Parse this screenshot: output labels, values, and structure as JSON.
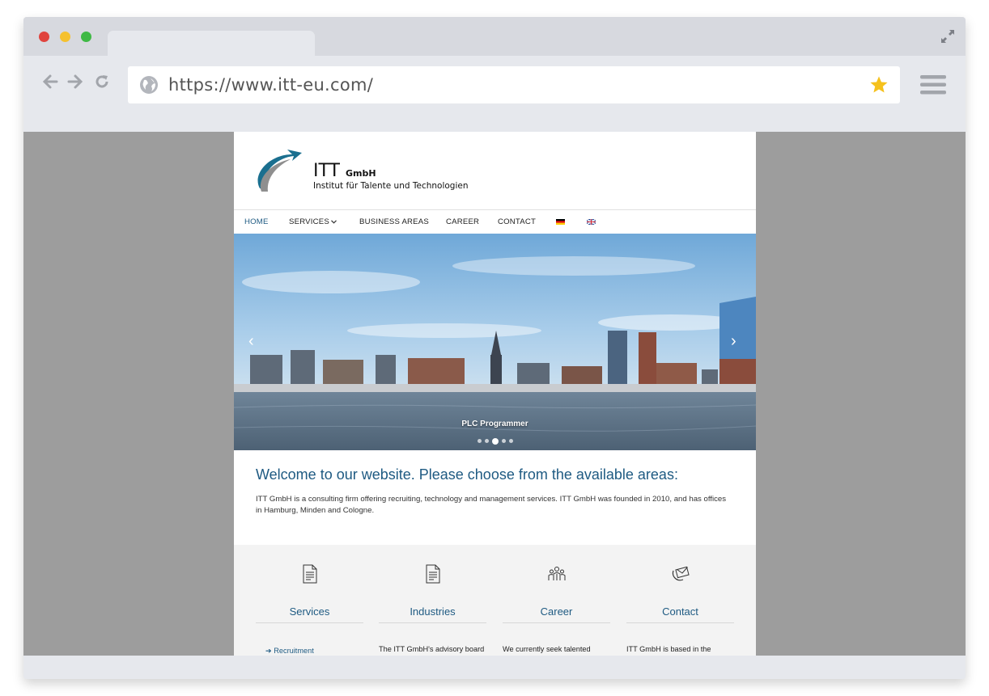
{
  "browser": {
    "url": "https://www.itt-eu.com/",
    "buttons": {
      "back": "back-arrow",
      "forward": "forward-arrow",
      "reload": "reload-icon",
      "bookmark": "star-icon",
      "menu": "hamburger-icon",
      "fullscreen": "expand-icon"
    },
    "traffic_light_colors": [
      "#e0443e",
      "#f5c12f",
      "#3fb945"
    ]
  },
  "site": {
    "logo": {
      "name": "ITT",
      "suffix": "GmbH",
      "tagline": "Institut für Talente und Technologien"
    },
    "nav": [
      {
        "label": "HOME",
        "active": true
      },
      {
        "label": "SERVICES",
        "has_dropdown": true
      },
      {
        "label": "BUSINESS AREAS"
      },
      {
        "label": "CAREER"
      },
      {
        "label": "CONTACT"
      }
    ],
    "languages": [
      "de-flag",
      "uk-flag"
    ],
    "hero": {
      "caption": "PLC Programmer",
      "slide_count": 5,
      "active_slide": 3
    },
    "welcome": {
      "title": "Welcome to our website. Please choose from the available areas:",
      "text": "ITT GmbH is a consulting firm offering recruiting, technology and management services. ITT GmbH was founded in 2010, and has offices in Hamburg, Minden and Cologne."
    },
    "features": [
      {
        "title": "Services",
        "icon": "document-list-icon",
        "link": "➔ Recruitment"
      },
      {
        "title": "Industries",
        "icon": "document-list-icon",
        "text": "The ITT GmbH's advisory board"
      },
      {
        "title": "Career",
        "icon": "people-group-icon",
        "text": "We currently seek talented"
      },
      {
        "title": "Contact",
        "icon": "mail-contact-icon",
        "text": "ITT GmbH is based in the"
      }
    ],
    "colors": {
      "accent": "#1e5a82",
      "feature_bg": "#f3f3f3",
      "outer_bg": "#9d9d9d"
    }
  }
}
